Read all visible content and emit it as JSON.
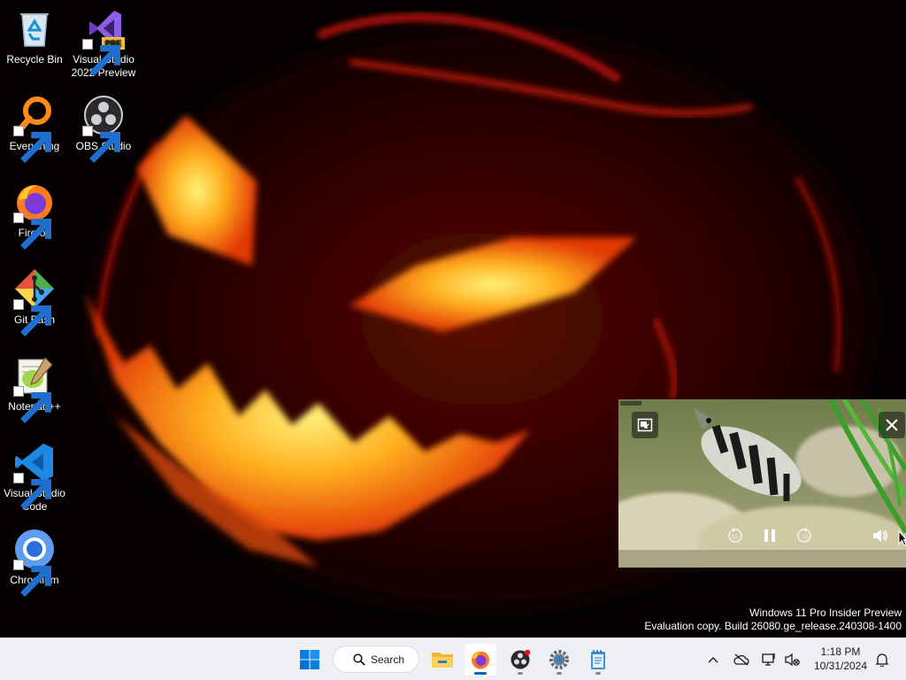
{
  "desktop": {
    "icons": [
      {
        "label": "Recycle Bin",
        "icon": "recycle-bin-icon"
      },
      {
        "label": "Visual Studio 2022 Preview",
        "icon": "visual-studio-icon",
        "badge": "PRE"
      },
      {
        "label": "Everything",
        "icon": "everything-search-icon"
      },
      {
        "label": "OBS Studio",
        "icon": "obs-studio-icon"
      },
      {
        "label": "Firefox",
        "icon": "firefox-icon"
      },
      {
        "label": "Git Bash",
        "icon": "git-bash-icon"
      },
      {
        "label": "Notepad++",
        "icon": "notepad-plus-plus-icon"
      },
      {
        "label": "Visual Studio Code",
        "icon": "vscode-icon"
      },
      {
        "label": "Chromium",
        "icon": "chromium-icon"
      }
    ],
    "wallpaper": "jack-o-lantern"
  },
  "watermark": {
    "line1": "Windows 11 Pro Insider Preview",
    "line2": "Evaluation copy. Build 26080.ge_release.240308-1400"
  },
  "pip": {
    "controls": [
      "back-to-tab",
      "close",
      "rewind-10",
      "pause",
      "forward-10",
      "volume"
    ]
  },
  "taskbar": {
    "search_label": "Search",
    "apps": [
      "start",
      "file-explorer",
      "firefox",
      "obs-studio",
      "settings",
      "notepad"
    ],
    "active_app": "firefox",
    "tray": {
      "time": "1:18 PM",
      "date": "10/31/2024"
    }
  },
  "colors": {
    "taskbar_bg": "#eef0f4",
    "accent": "#0067c0",
    "pumpkin_glow": "#ffcc33"
  }
}
